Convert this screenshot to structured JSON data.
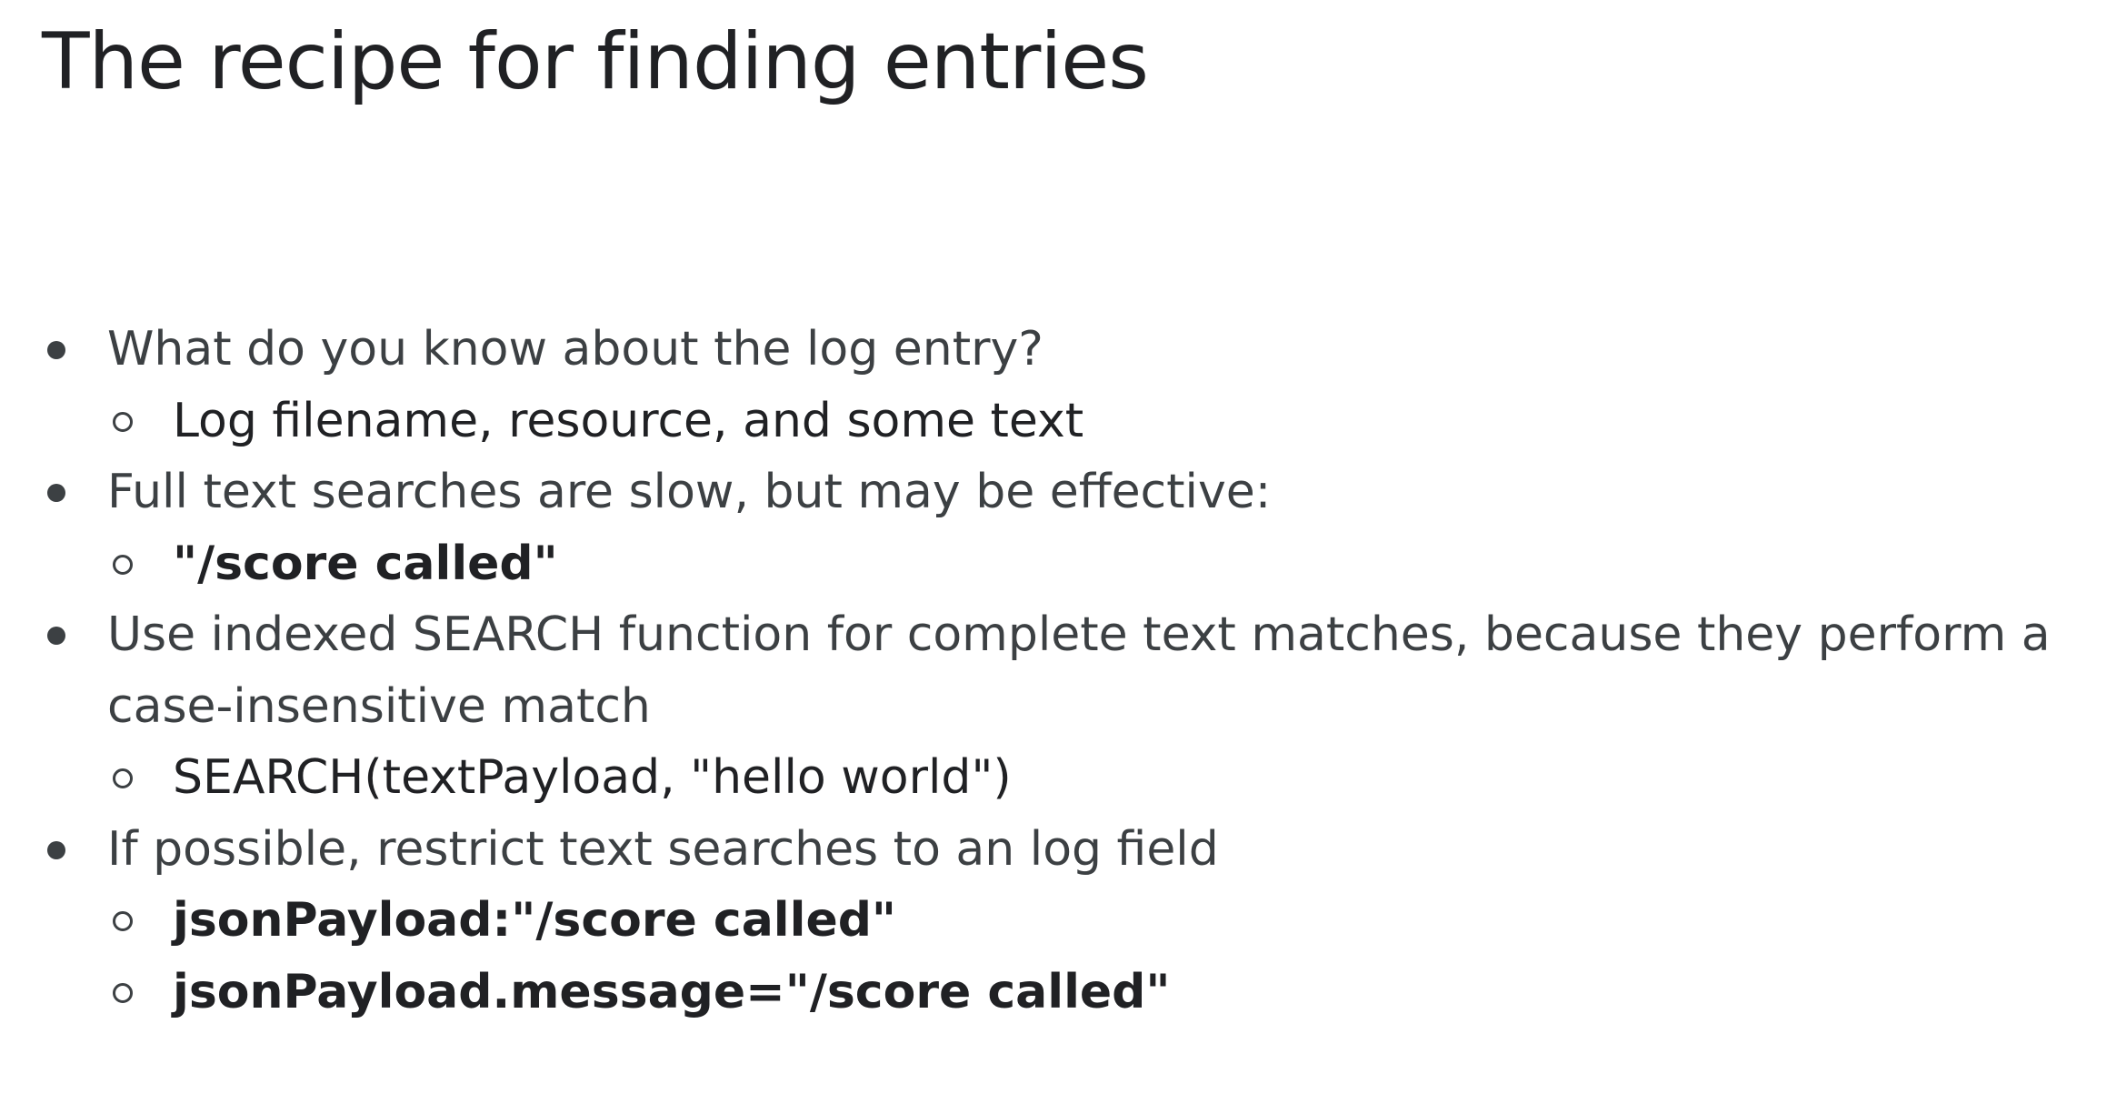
{
  "title": "The recipe for finding entries",
  "bullets": [
    {
      "text": "What do you know about the log entry?",
      "subs": [
        {
          "text": "Log filename, resource, and some text",
          "style": "plain"
        }
      ]
    },
    {
      "text": "Full text searches are slow, but may be effective:",
      "subs": [
        {
          "text": "\"/score called\"",
          "style": "bold"
        }
      ]
    },
    {
      "text": "Use indexed SEARCH function for complete text matches, because they perform a case-insensitive match",
      "subs": [
        {
          "text": "SEARCH(textPayload, \"hello world\")",
          "style": "plain"
        }
      ]
    },
    {
      "text": "If possible, restrict text searches to an log field",
      "subs": [
        {
          "text": "jsonPayload:\"/score called\"",
          "style": "bold"
        },
        {
          "text": "jsonPayload.message=\"/score called\"",
          "style": "bold"
        }
      ]
    }
  ]
}
